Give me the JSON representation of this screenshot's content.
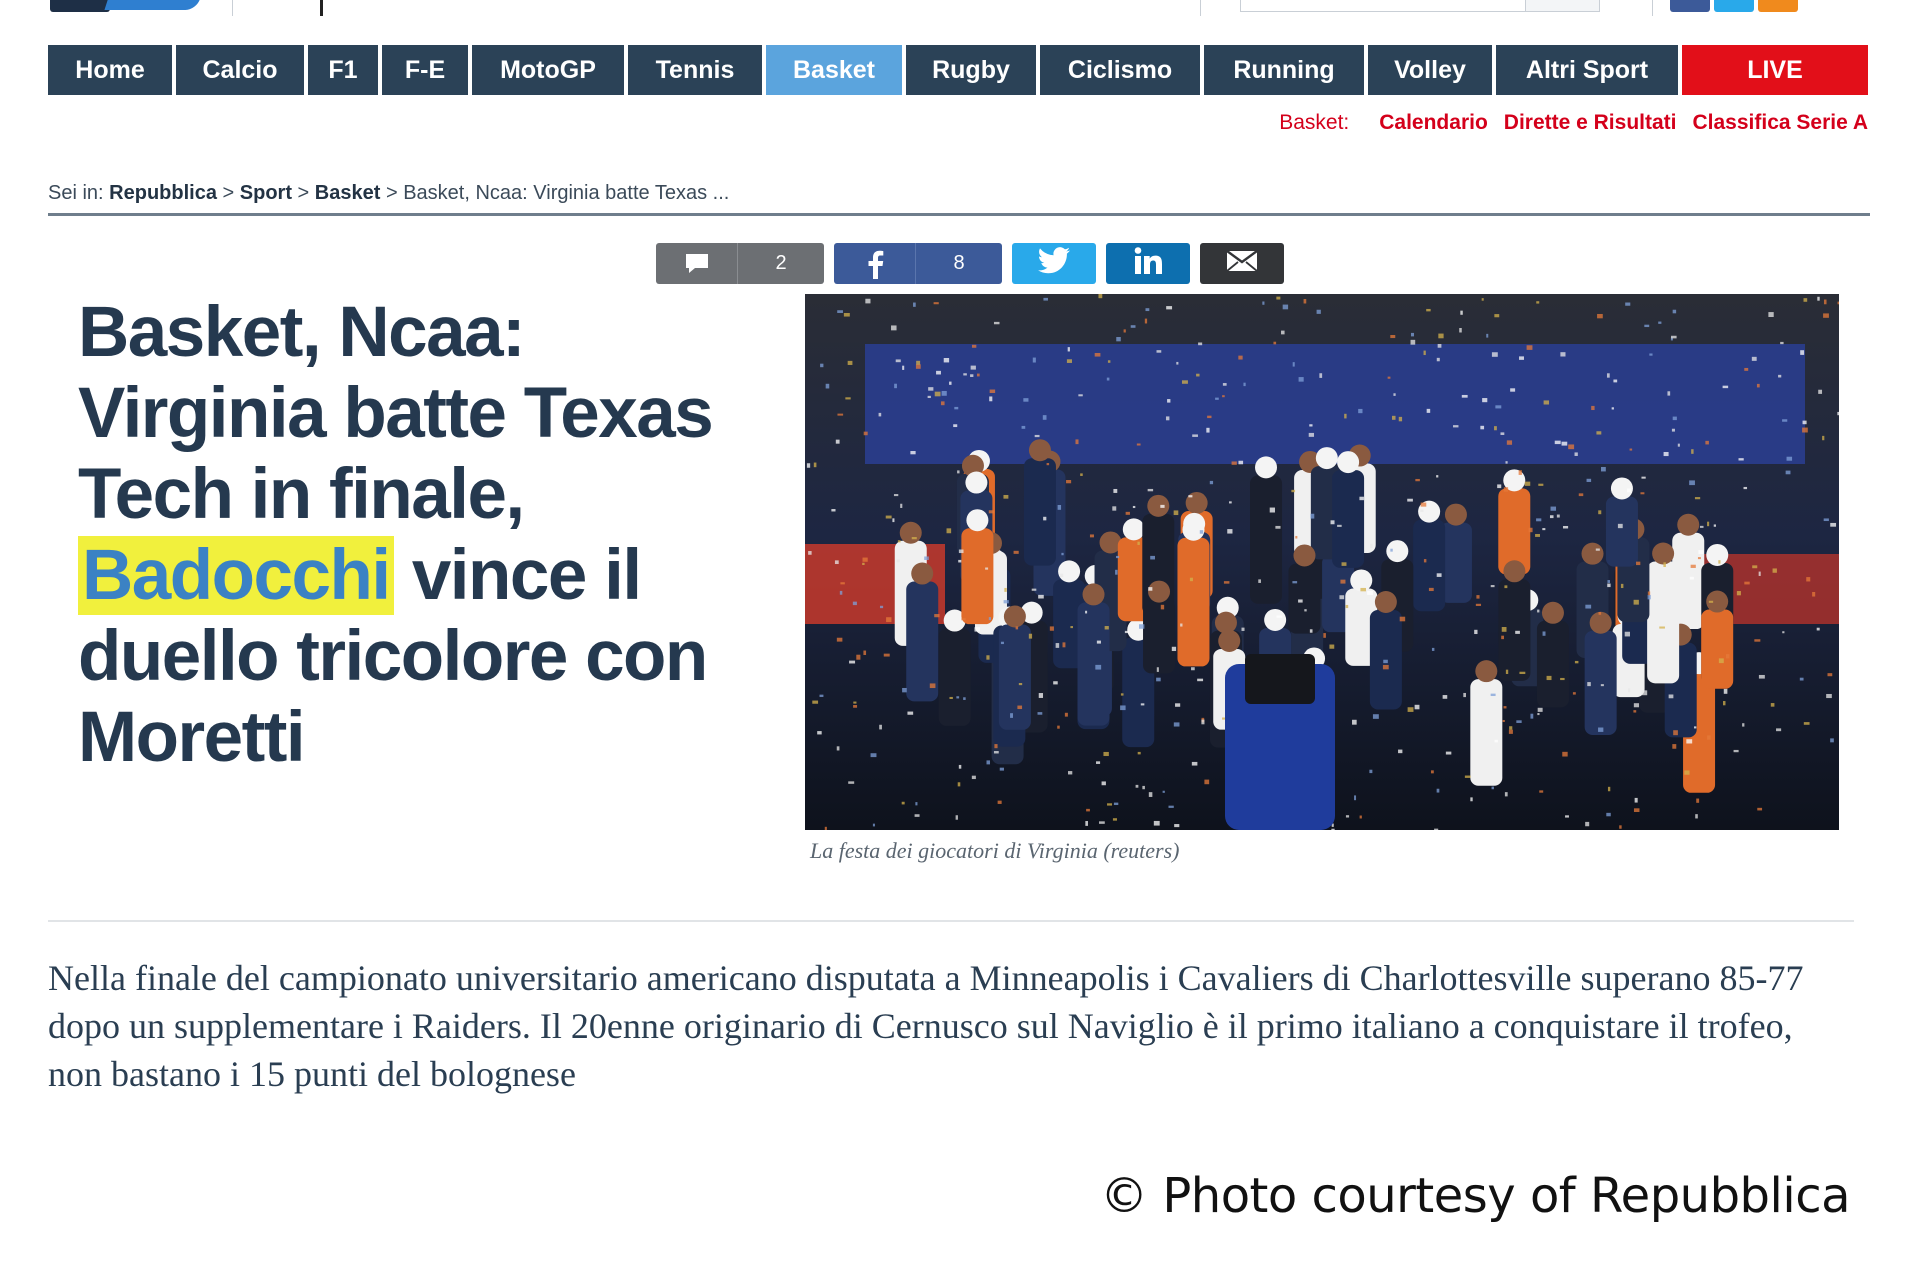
{
  "nav": {
    "items": [
      {
        "label": "Home",
        "width": 124
      },
      {
        "label": "Calcio",
        "width": 128
      },
      {
        "label": "F1",
        "width": 70
      },
      {
        "label": "F-E",
        "width": 86
      },
      {
        "label": "MotoGP",
        "width": 152
      },
      {
        "label": "Tennis",
        "width": 134
      },
      {
        "label": "Basket",
        "width": 136
      },
      {
        "label": "Rugby",
        "width": 130
      },
      {
        "label": "Ciclismo",
        "width": 160
      },
      {
        "label": "Running",
        "width": 160
      },
      {
        "label": "Volley",
        "width": 124
      },
      {
        "label": "Altri Sport",
        "width": 182
      },
      {
        "label": "LIVE",
        "width": 186
      }
    ],
    "active": "Basket",
    "colors": {
      "bar": "#2b4257",
      "active": "#5ba4dd",
      "live": "#e20f19"
    }
  },
  "subnav": {
    "lead": "Basket:",
    "links": [
      "Calendario",
      "Dirette e Risultati",
      "Classifica Serie A"
    ],
    "color": "#d4001b"
  },
  "breadcrumb": {
    "prefix": "Sei in:",
    "items": [
      "Repubblica",
      "Sport",
      "Basket"
    ],
    "current": "Basket, Ncaa: Virginia batte Texas ...",
    "separator": ">"
  },
  "share": {
    "comments_icon": "comment-bubble-icon",
    "comments_count": "2",
    "facebook_icon": "facebook-icon",
    "facebook_count": "8",
    "twitter_icon": "twitter-icon",
    "linkedin_icon": "linkedin-icon",
    "email_icon": "email-icon"
  },
  "article": {
    "headline_lines": [
      "Basket, Ncaa:",
      "Virginia batte Texas",
      "Tech in finale,",
      "vince il",
      "duello tricolore con",
      "Moretti"
    ],
    "highlight": "Badocchi",
    "highlight_color": "#f1f03d",
    "image_caption": "La festa dei giocatori di Virginia (reuters)",
    "summary": "Nella finale del campionato universitario americano disputata a Minneapolis i Cavaliers di Charlottesville superano  85-77 dopo un supplementare i Raiders. Il 20enne originario di Cernusco sul Naviglio è il primo italiano a conquistare il trofeo, non bastano i 15 punti del bolognese"
  },
  "credit": "© Photo courtesy of Repubblica"
}
